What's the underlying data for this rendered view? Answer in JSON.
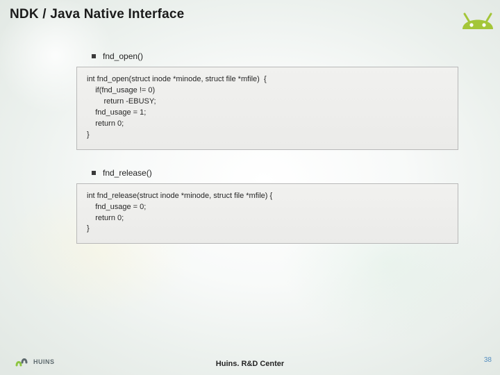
{
  "title": "NDK / Java Native Interface",
  "icons": {
    "android": "android-robot-icon",
    "huins": "huins-logo-icon"
  },
  "bullets": [
    {
      "label": "fnd_open()"
    },
    {
      "label": "fnd_release()"
    }
  ],
  "code_blocks": [
    "int fnd_open(struct inode *minode, struct file *mfile)  {\n    if(fnd_usage != 0)\n        return -EBUSY;\n    fnd_usage = 1;\n    return 0;\n}",
    "int fnd_release(struct inode *minode, struct file *mfile) {\n    fnd_usage = 0;\n    return 0;\n}"
  ],
  "footer": {
    "logo_text": "HUINS",
    "center": "Huins. R&D Center",
    "page": "38"
  },
  "colors": {
    "android_green": "#A4C639",
    "huins_green": "#8CC540",
    "page_blue": "#538dc0"
  }
}
